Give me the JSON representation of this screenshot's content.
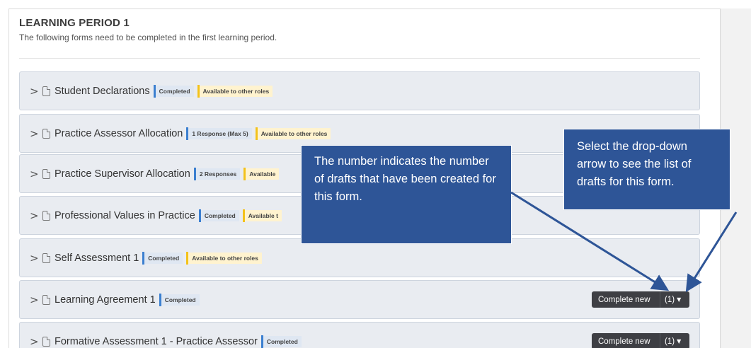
{
  "section": {
    "title": "LEARNING PERIOD 1",
    "description": "The following forms need to be completed in the first learning period."
  },
  "forms": [
    {
      "name": "Student Declarations",
      "badges": [
        "Completed",
        "Available to other roles"
      ]
    },
    {
      "name": "Practice Assessor Allocation",
      "badges": [
        "1 Response (Max 5)",
        "Available to other roles"
      ]
    },
    {
      "name": "Practice Supervisor Allocation",
      "badges": [
        "2 Responses",
        "Available"
      ]
    },
    {
      "name": "Professional Values in Practice",
      "badges": [
        "Completed",
        "Available t"
      ]
    },
    {
      "name": "Self Assessment 1",
      "badges": [
        "Completed",
        "Available to other roles"
      ]
    },
    {
      "name": "Learning Agreement 1",
      "badges": [
        "Completed"
      ],
      "action": {
        "label": "Complete new",
        "count": "(1)"
      }
    },
    {
      "name": "Formative Assessment 1 - Practice Assessor",
      "badges": [
        "Completed"
      ],
      "action": {
        "label": "Complete new",
        "count": "(1)"
      }
    }
  ],
  "callouts": {
    "drafts_count": "The number indicates the number of drafts that have been created for this form.",
    "dropdown": "Select the drop-down arrow to see the list of drafts for this form."
  },
  "icons": {
    "expand": "chevron-right-icon",
    "form": "document-icon",
    "dropdown": "caret-down-icon"
  },
  "colors": {
    "callout_bg": "#2e5597",
    "completed_bar": "#3b7fd0",
    "available_bar": "#f3c21a",
    "button_bg": "#3e3f44"
  }
}
